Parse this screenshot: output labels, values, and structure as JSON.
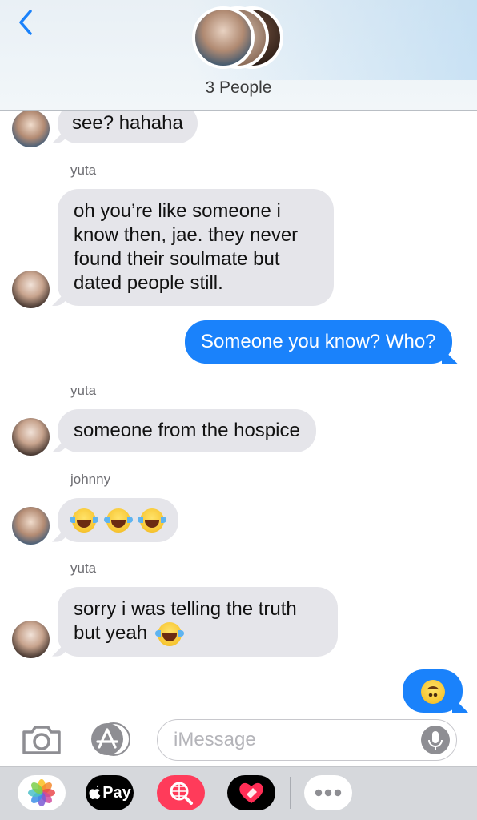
{
  "header": {
    "group_title": "3 People"
  },
  "messages": [
    {
      "from": "johnny",
      "text": "see? hahaha"
    },
    {
      "sender_label": "yuta",
      "text": "oh you’re like someone i know then, jae. they never found their soulmate but dated people still."
    },
    {
      "from": "me",
      "text": "Someone you know? Who?"
    },
    {
      "sender_label": "yuta",
      "text": "someone from the hospice"
    },
    {
      "sender_label": "johnny",
      "text": "😂😂😂"
    },
    {
      "sender_label": "yuta",
      "text_line1": "sorry i was telling the truth",
      "text_line2": "but yeah"
    },
    {
      "from": "me",
      "text": "🙃"
    }
  ],
  "composer": {
    "placeholder": "iMessage"
  },
  "app_drawer": {
    "pay_label": "Pay"
  },
  "colors": {
    "outgoing_bubble": "#1a82fb",
    "incoming_bubble": "#e5e5ea",
    "back_arrow": "#1a82fb"
  },
  "icons": [
    "chevron-left-icon",
    "camera-icon",
    "app-store-icon",
    "microphone-icon",
    "photos-icon",
    "apple-pay-icon",
    "web-search-icon",
    "digital-touch-icon",
    "more-icon"
  ]
}
